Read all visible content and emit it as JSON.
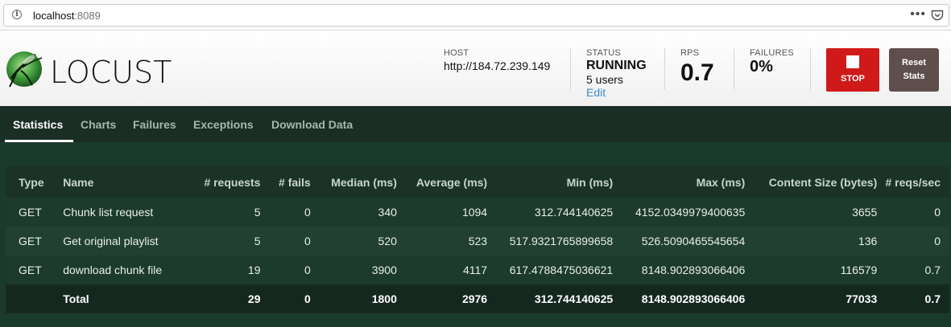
{
  "browser": {
    "url_host": "localhost",
    "url_port": ":8089"
  },
  "header": {
    "logo_text": "LOCUST",
    "host_label": "HOST",
    "host_value": "http://184.72.239.149",
    "status_label": "STATUS",
    "status_value": "RUNNING",
    "users_value": "5 users",
    "edit_label": "Edit",
    "rps_label": "RPS",
    "rps_value": "0.7",
    "failures_label": "FAILURES",
    "failures_value": "0%",
    "stop_label": "STOP",
    "reset_label_line1": "Reset",
    "reset_label_line2": "Stats"
  },
  "tabs": [
    {
      "label": "Statistics",
      "active": true
    },
    {
      "label": "Charts",
      "active": false
    },
    {
      "label": "Failures",
      "active": false
    },
    {
      "label": "Exceptions",
      "active": false
    },
    {
      "label": "Download Data",
      "active": false
    }
  ],
  "table": {
    "columns": [
      "Type",
      "Name",
      "# requests",
      "# fails",
      "Median (ms)",
      "Average (ms)",
      "Min (ms)",
      "Max (ms)",
      "Content Size (bytes)",
      "# reqs/sec"
    ],
    "rows": [
      [
        "GET",
        "Chunk list request",
        "5",
        "0",
        "340",
        "1094",
        "312.744140625",
        "4152.0349979400635",
        "3655",
        "0"
      ],
      [
        "GET",
        "Get original playlist",
        "5",
        "0",
        "520",
        "523",
        "517.9321765899658",
        "526.5090465545654",
        "136",
        "0"
      ],
      [
        "GET",
        "download chunk file",
        "19",
        "0",
        "3900",
        "4117",
        "617.4788475036621",
        "8148.902893066406",
        "116579",
        "0.7"
      ]
    ],
    "total": [
      "",
      "Total",
      "29",
      "0",
      "1800",
      "2976",
      "312.744140625",
      "8148.902893066406",
      "77033",
      "0.7"
    ]
  },
  "colors": {
    "stop_button": "#d01a1a",
    "reset_button": "#5f4f4c",
    "edit_link": "#3a8fd0",
    "background": "#1b3a2e"
  }
}
